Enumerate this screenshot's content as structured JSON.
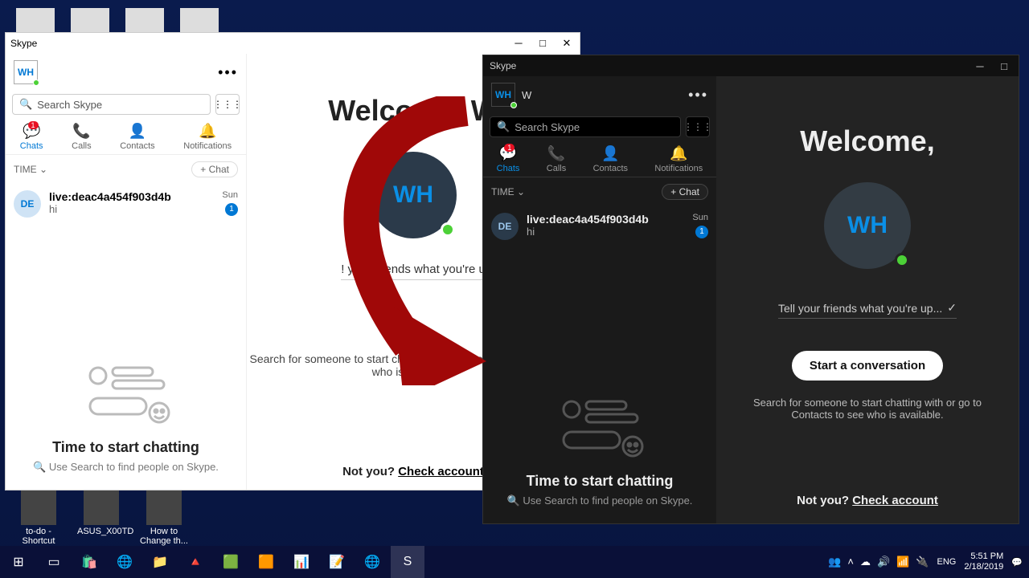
{
  "desktop": {
    "icons_bottom": [
      "to-do - Shortcut",
      "ASUS_X00TD",
      "How to Change th..."
    ]
  },
  "light": {
    "window_title": "Skype",
    "profile_initials": "WH",
    "search_placeholder": "Search Skype",
    "tabs": {
      "chats": "Chats",
      "calls": "Calls",
      "contacts": "Contacts",
      "notifs": "Notifications",
      "badge": "1"
    },
    "time_label": "TIME",
    "chat_button": "+ Chat",
    "convo": {
      "avatar": "DE",
      "name": "live:deac4a454f903d4b",
      "msg": "hi",
      "day": "Sun",
      "unread": "1"
    },
    "empty_title": "Time to start chatting",
    "empty_sub": "Use Search to find people on Skype.",
    "welcome_heading": "Welcome, W",
    "avatar_big": "WH",
    "status_line": "! your friends what you're u",
    "search_desc": "Search for someone to start chatting with or go to Contacts to see who is available.",
    "notyou_prefix": "Not you? ",
    "notyou_link": "Check account"
  },
  "dark": {
    "window_title": "Skype",
    "profile_initials": "WH",
    "profile_short": "W",
    "search_placeholder": "Search Skype",
    "tabs": {
      "chats": "Chats",
      "calls": "Calls",
      "contacts": "Contacts",
      "notifs": "Notifications",
      "badge": "1"
    },
    "time_label": "TIME",
    "chat_button": "+ Chat",
    "convo": {
      "avatar": "DE",
      "name": "live:deac4a454f903d4b",
      "msg": "hi",
      "day": "Sun",
      "unread": "1"
    },
    "empty_title": "Time to start chatting",
    "empty_sub": "Use Search to find people on Skype.",
    "welcome_heading": "Welcome,",
    "avatar_big": "WH",
    "status_line": "Tell your friends what you're up...",
    "start_button": "Start a conversation",
    "search_desc": "Search for someone to start chatting with or go to Contacts to see who is available.",
    "notyou_prefix": "Not you? ",
    "notyou_link": "Check account"
  },
  "taskbar": {
    "lang": "ENG",
    "time": "5:51 PM",
    "date": "2/18/2019"
  }
}
